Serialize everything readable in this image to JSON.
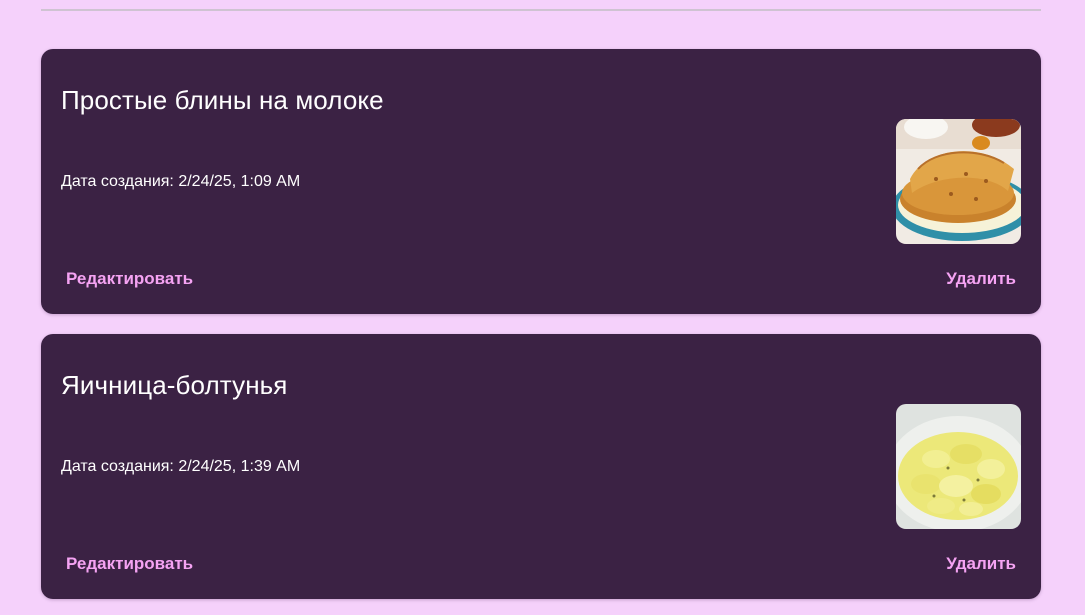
{
  "recipes": [
    {
      "title": "Простые блины на молоке",
      "date_label": "Дата создания: 2/24/25, 1:09 AM",
      "image_name": "pancakes-photo",
      "edit_label": "Редактировать",
      "delete_label": "Удалить"
    },
    {
      "title": "Яичница-болтунья",
      "date_label": "Дата создания: 2/24/25, 1:39 AM",
      "image_name": "scrambled-eggs-photo",
      "edit_label": "Редактировать",
      "delete_label": "Удалить"
    }
  ],
  "colors": {
    "page_bg": "#f5d1fb",
    "card_bg": "#3b2244",
    "accent": "#f5a3f3",
    "text": "#ffffff"
  }
}
